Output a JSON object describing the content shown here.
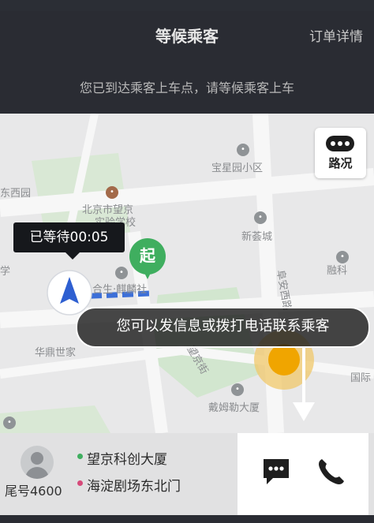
{
  "header": {
    "title": "等候乘客",
    "order_detail": "订单详情",
    "subtitle": "您已到达乘客上车点，请等候乘客上车"
  },
  "map": {
    "labels": {
      "baoxing": "宝星园小区",
      "dongxiyuan": "东西园",
      "beijing_wangjing_1": "北京市望京",
      "beijing_wangjing_2": "实验学校",
      "xinsheng": "新荟城",
      "rongke": "融科",
      "left_partial": "学",
      "hesheng": "合生·麒麟社",
      "huading": "华鼎世家",
      "wangjing_street": "望京街",
      "fuan_road": "阜安西路",
      "damu": "戴姆勒大厦",
      "guoji": "国际"
    },
    "traffic_button": {
      "label": "路况",
      "icon": "traffic-dots-icon"
    }
  },
  "wait_tip": "已等待00:05",
  "start_marker": "起",
  "hint": "您可以发信息或拨打电话联系乘客",
  "driver": {
    "tail_number": "尾号4600"
  },
  "route": {
    "origin": "望京科创大厦",
    "destination": "海淀剧场东北门",
    "origin_color": "#3fae5f",
    "destination_color": "#d64a7a"
  },
  "actions": {
    "message_icon": "message-icon",
    "call_icon": "phone-icon"
  },
  "colors": {
    "header_bg": "#2a2c33",
    "accent_green": "#3fae5f"
  }
}
